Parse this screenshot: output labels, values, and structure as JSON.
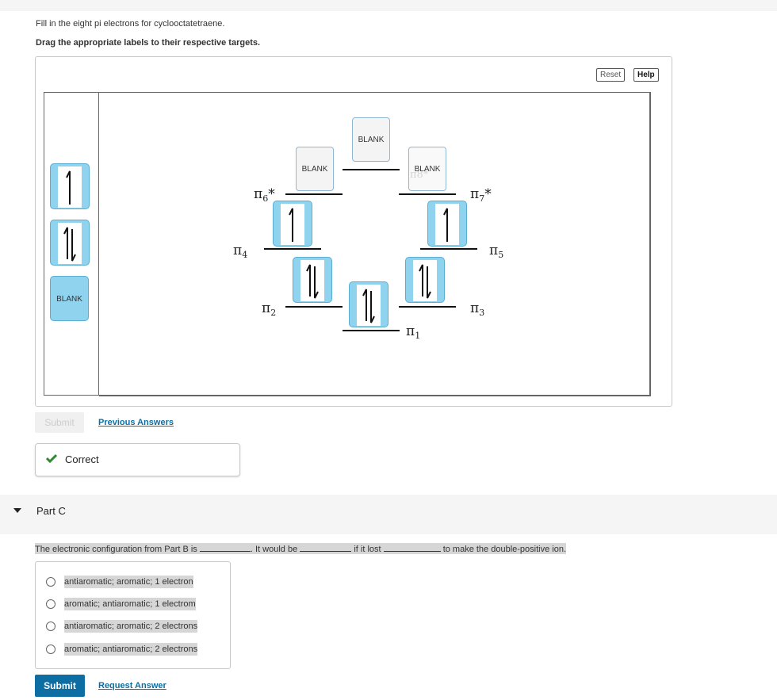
{
  "instructions": {
    "line1": "Fill in the eight pi electrons for cyclooctatetraene.",
    "line2": "Drag the appropriate labels to their respective targets."
  },
  "toolbar": {
    "reset": "Reset",
    "help": "Help"
  },
  "tray": {
    "chips": [
      {
        "icon": "single-up-arrow-icon"
      },
      {
        "icon": "paired-up-down-arrows-icon"
      },
      {
        "label": "BLANK"
      }
    ]
  },
  "diagram": {
    "levels": [
      {
        "name": "π",
        "sub": "1",
        "filled": "paired"
      },
      {
        "name": "π",
        "sub": "2",
        "filled": "paired"
      },
      {
        "name": "π",
        "sub": "3",
        "filled": "paired"
      },
      {
        "name": "π",
        "sub": "4",
        "filled": "single"
      },
      {
        "name": "π",
        "sub": "5",
        "filled": "single"
      },
      {
        "name": "π",
        "sub": "6",
        "star": "*",
        "filled": "BLANK"
      },
      {
        "name": "π",
        "sub": "7",
        "star": "*",
        "filled": "BLANK"
      },
      {
        "name": "π",
        "sub": "8",
        "star": "*",
        "filled": "BLANK"
      }
    ],
    "blank_label": "BLANK"
  },
  "partB": {
    "submit": "Submit",
    "previous_answers": "Previous Answers",
    "feedback": "Correct"
  },
  "partC": {
    "title": "Part C",
    "sentence": {
      "s1": "The electronic configuration from Part B is",
      "s2": ". It would be",
      "s3": "if it lost",
      "s4": "to make the double-positive ion."
    },
    "options": [
      "antiaromatic; aromatic; 1 electron",
      "aromatic; antiaromatic; 1 electrom",
      "antiaromatic; aromatic; 2 electrons",
      "aromatic; antiaromatic; 2 electrons"
    ],
    "submit": "Submit",
    "request_answer": "Request Answer"
  },
  "colors": {
    "accent": "#0d6ea3",
    "chip": "#8fd3ee",
    "correct": "#2e8b2e"
  }
}
